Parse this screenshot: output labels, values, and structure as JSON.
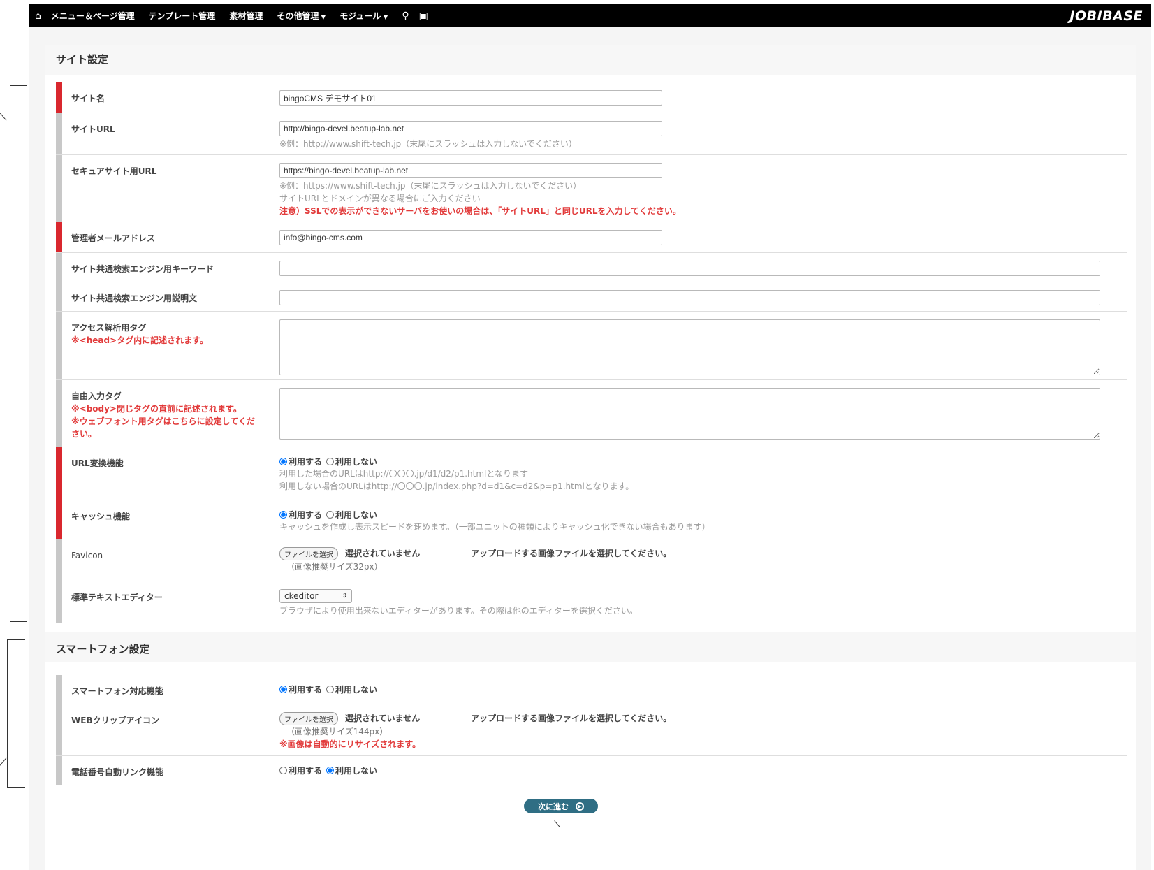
{
  "topbar": {
    "home_icon": "home-icon",
    "menu_items": [
      "メニュー＆ページ管理",
      "テンプレート管理",
      "素材管理",
      "その他管理",
      "モジュール"
    ],
    "search_icon": "search-icon",
    "export_icon": "export-icon",
    "brand": "JOBIBASE"
  },
  "site_settings": {
    "title": "サイト設定",
    "site_name": {
      "label": "サイト名",
      "value": "bingoCMS デモサイト01"
    },
    "site_url": {
      "label": "サイトURL",
      "value": "http://bingo-devel.beatup-lab.net",
      "hint": "※例：http://www.shift-tech.jp（末尾にスラッシュは入力しないでください）"
    },
    "secure_url": {
      "label": "セキュアサイト用URL",
      "value": "https://bingo-devel.beatup-lab.net",
      "hint1": "※例：https://www.shift-tech.jp（末尾にスラッシュは入力しないでください）",
      "hint2": "サイトURLとドメインが異なる場合にご入力ください",
      "hint3": "注意）SSLでの表示ができないサーバをお使いの場合は、「サイトURL」と同じURLを入力してください。"
    },
    "admin_email": {
      "label": "管理者メールアドレス",
      "value": "info@bingo-cms.com"
    },
    "seo_keyword": {
      "label": "サイト共通検索エンジン用キーワード",
      "value": ""
    },
    "seo_description": {
      "label": "サイト共通検索エンジン用説明文",
      "value": ""
    },
    "access_tag": {
      "label": "アクセス解析用タグ",
      "note": "※<head>タグ内に記述されます。",
      "value": ""
    },
    "free_tag": {
      "label": "自由入力タグ",
      "note1": "※<body>閉じタグの直前に記述されます。",
      "note2": "※ウェブフォント用タグはこちらに設定してください。",
      "value": ""
    },
    "url_convert": {
      "label": "URL変換機能",
      "opt_use": "利用する",
      "opt_nouse": "利用しない",
      "selected": "use",
      "hint1": "利用した場合のURLはhttp://〇〇〇.jp/d1/d2/p1.htmlとなります",
      "hint2": "利用しない場合のURLはhttp://〇〇〇.jp/index.php?d=d1&c=d2&p=p1.htmlとなります。"
    },
    "cache": {
      "label": "キャッシュ機能",
      "opt_use": "利用する",
      "opt_nouse": "利用しない",
      "selected": "use",
      "hint": "キャッシュを作成し表示スピードを速めます。（一部ユニットの種類によりキャッシュ化できない場合もあります）"
    },
    "favicon": {
      "label": "Favicon",
      "button": "ファイルを選択",
      "status": "選択されていません",
      "upload_note": "アップロードする画像ファイルを選択してください。",
      "size": "（画像推奨サイズ32px）"
    },
    "editor": {
      "label": "標準テキストエディター",
      "selected": "ckeditor",
      "hint": "ブラウザにより使用出来ないエディターがあります。その際は他のエディターを選択ください。"
    }
  },
  "smartphone_settings": {
    "title": "スマートフォン設定",
    "sp_support": {
      "label": "スマートフォン対応機能",
      "opt_use": "利用する",
      "opt_nouse": "利用しない",
      "selected": "use"
    },
    "web_clip": {
      "label": "WEBクリップアイコン",
      "button": "ファイルを選択",
      "status": "選択されていません",
      "upload_note": "アップロードする画像ファイルを選択してください。",
      "size": "（画像推奨サイズ144px）",
      "note": "※画像は自動的にリサイズされます。"
    },
    "tel_link": {
      "label": "電話番号自動リンク機能",
      "opt_use": "利用する",
      "opt_nouse": "利用しない",
      "selected": "nouse"
    }
  },
  "submit": {
    "label": "次に進む",
    "icon": "arrow-right-circle-icon"
  }
}
